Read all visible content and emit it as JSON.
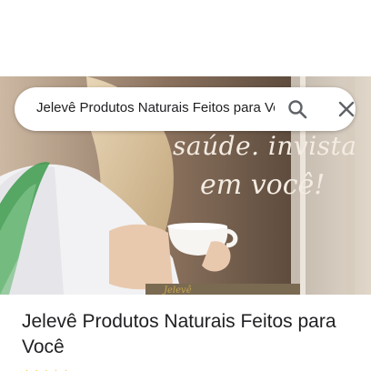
{
  "search": {
    "query": "Jelevê Produtos Naturais Feitos para Você"
  },
  "icons": {
    "search": "search-icon",
    "close": "close-icon",
    "rating": "star-icon"
  },
  "hero": {
    "overlay_line1": "saúde. invista",
    "overlay_line2": "em você!"
  },
  "place": {
    "title": "Jelevê Produtos Naturais Feitos para Você"
  },
  "colors": {
    "text_primary": "#202124",
    "icon_gray": "#5f6368",
    "star": "#f4b400"
  }
}
